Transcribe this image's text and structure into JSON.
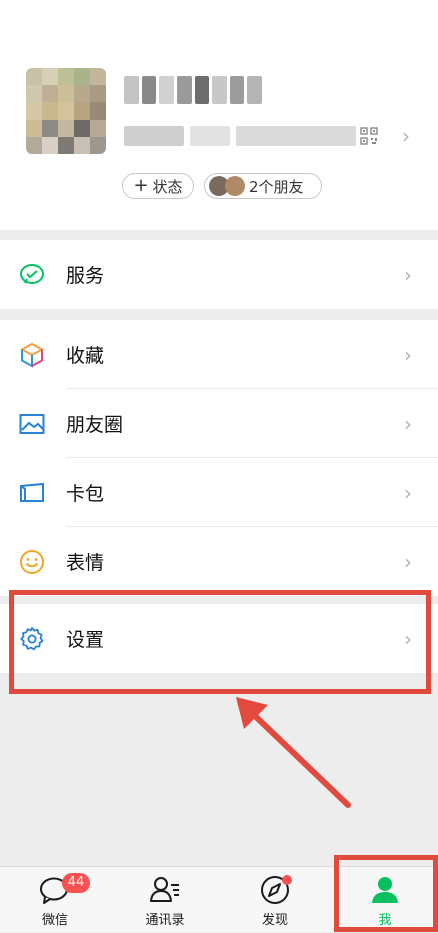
{
  "profile": {
    "status_button": "状态",
    "friends_button": "2个朋友"
  },
  "menu": {
    "services": "服务",
    "favorites": "收藏",
    "moments": "朋友圈",
    "cards": "卡包",
    "stickers": "表情",
    "settings": "设置"
  },
  "tabs": [
    {
      "label": "微信",
      "badge": "44"
    },
    {
      "label": "通讯录"
    },
    {
      "label": "发现"
    },
    {
      "label": "我"
    }
  ],
  "colors": {
    "accent": "#07c160",
    "badge": "#fa5151",
    "highlight": "#e24a3e"
  }
}
